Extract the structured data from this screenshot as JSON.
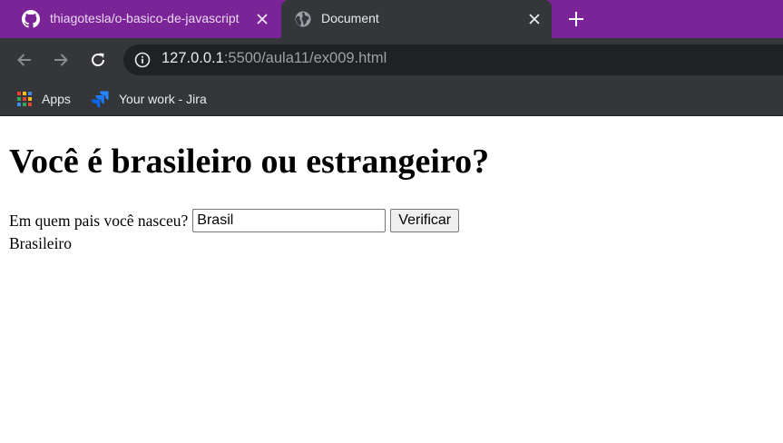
{
  "browser": {
    "tabs": [
      {
        "title": "thiagotesla/o-basico-de-javascript",
        "icon": "github-icon",
        "active": false
      },
      {
        "title": "Document",
        "icon": "globe-icon",
        "active": true
      }
    ],
    "url": {
      "host": "127.0.0.1",
      "rest": ":5500/aula11/ex009.html"
    },
    "bookmarks": [
      {
        "label": "Apps",
        "icon": "apps-grid-icon"
      },
      {
        "label": "Your work - Jira",
        "icon": "jira-icon"
      }
    ],
    "colors": {
      "tabstrip": "#7b2497",
      "toolbar": "#35363a",
      "omnibox": "#202124"
    }
  },
  "page": {
    "heading": "Você é brasileiro ou estrangeiro?",
    "question_label": "Em quem pais você nasceu?",
    "country_input_value": "Brasil",
    "verify_button_label": "Verificar",
    "result_text": "Brasileiro"
  }
}
